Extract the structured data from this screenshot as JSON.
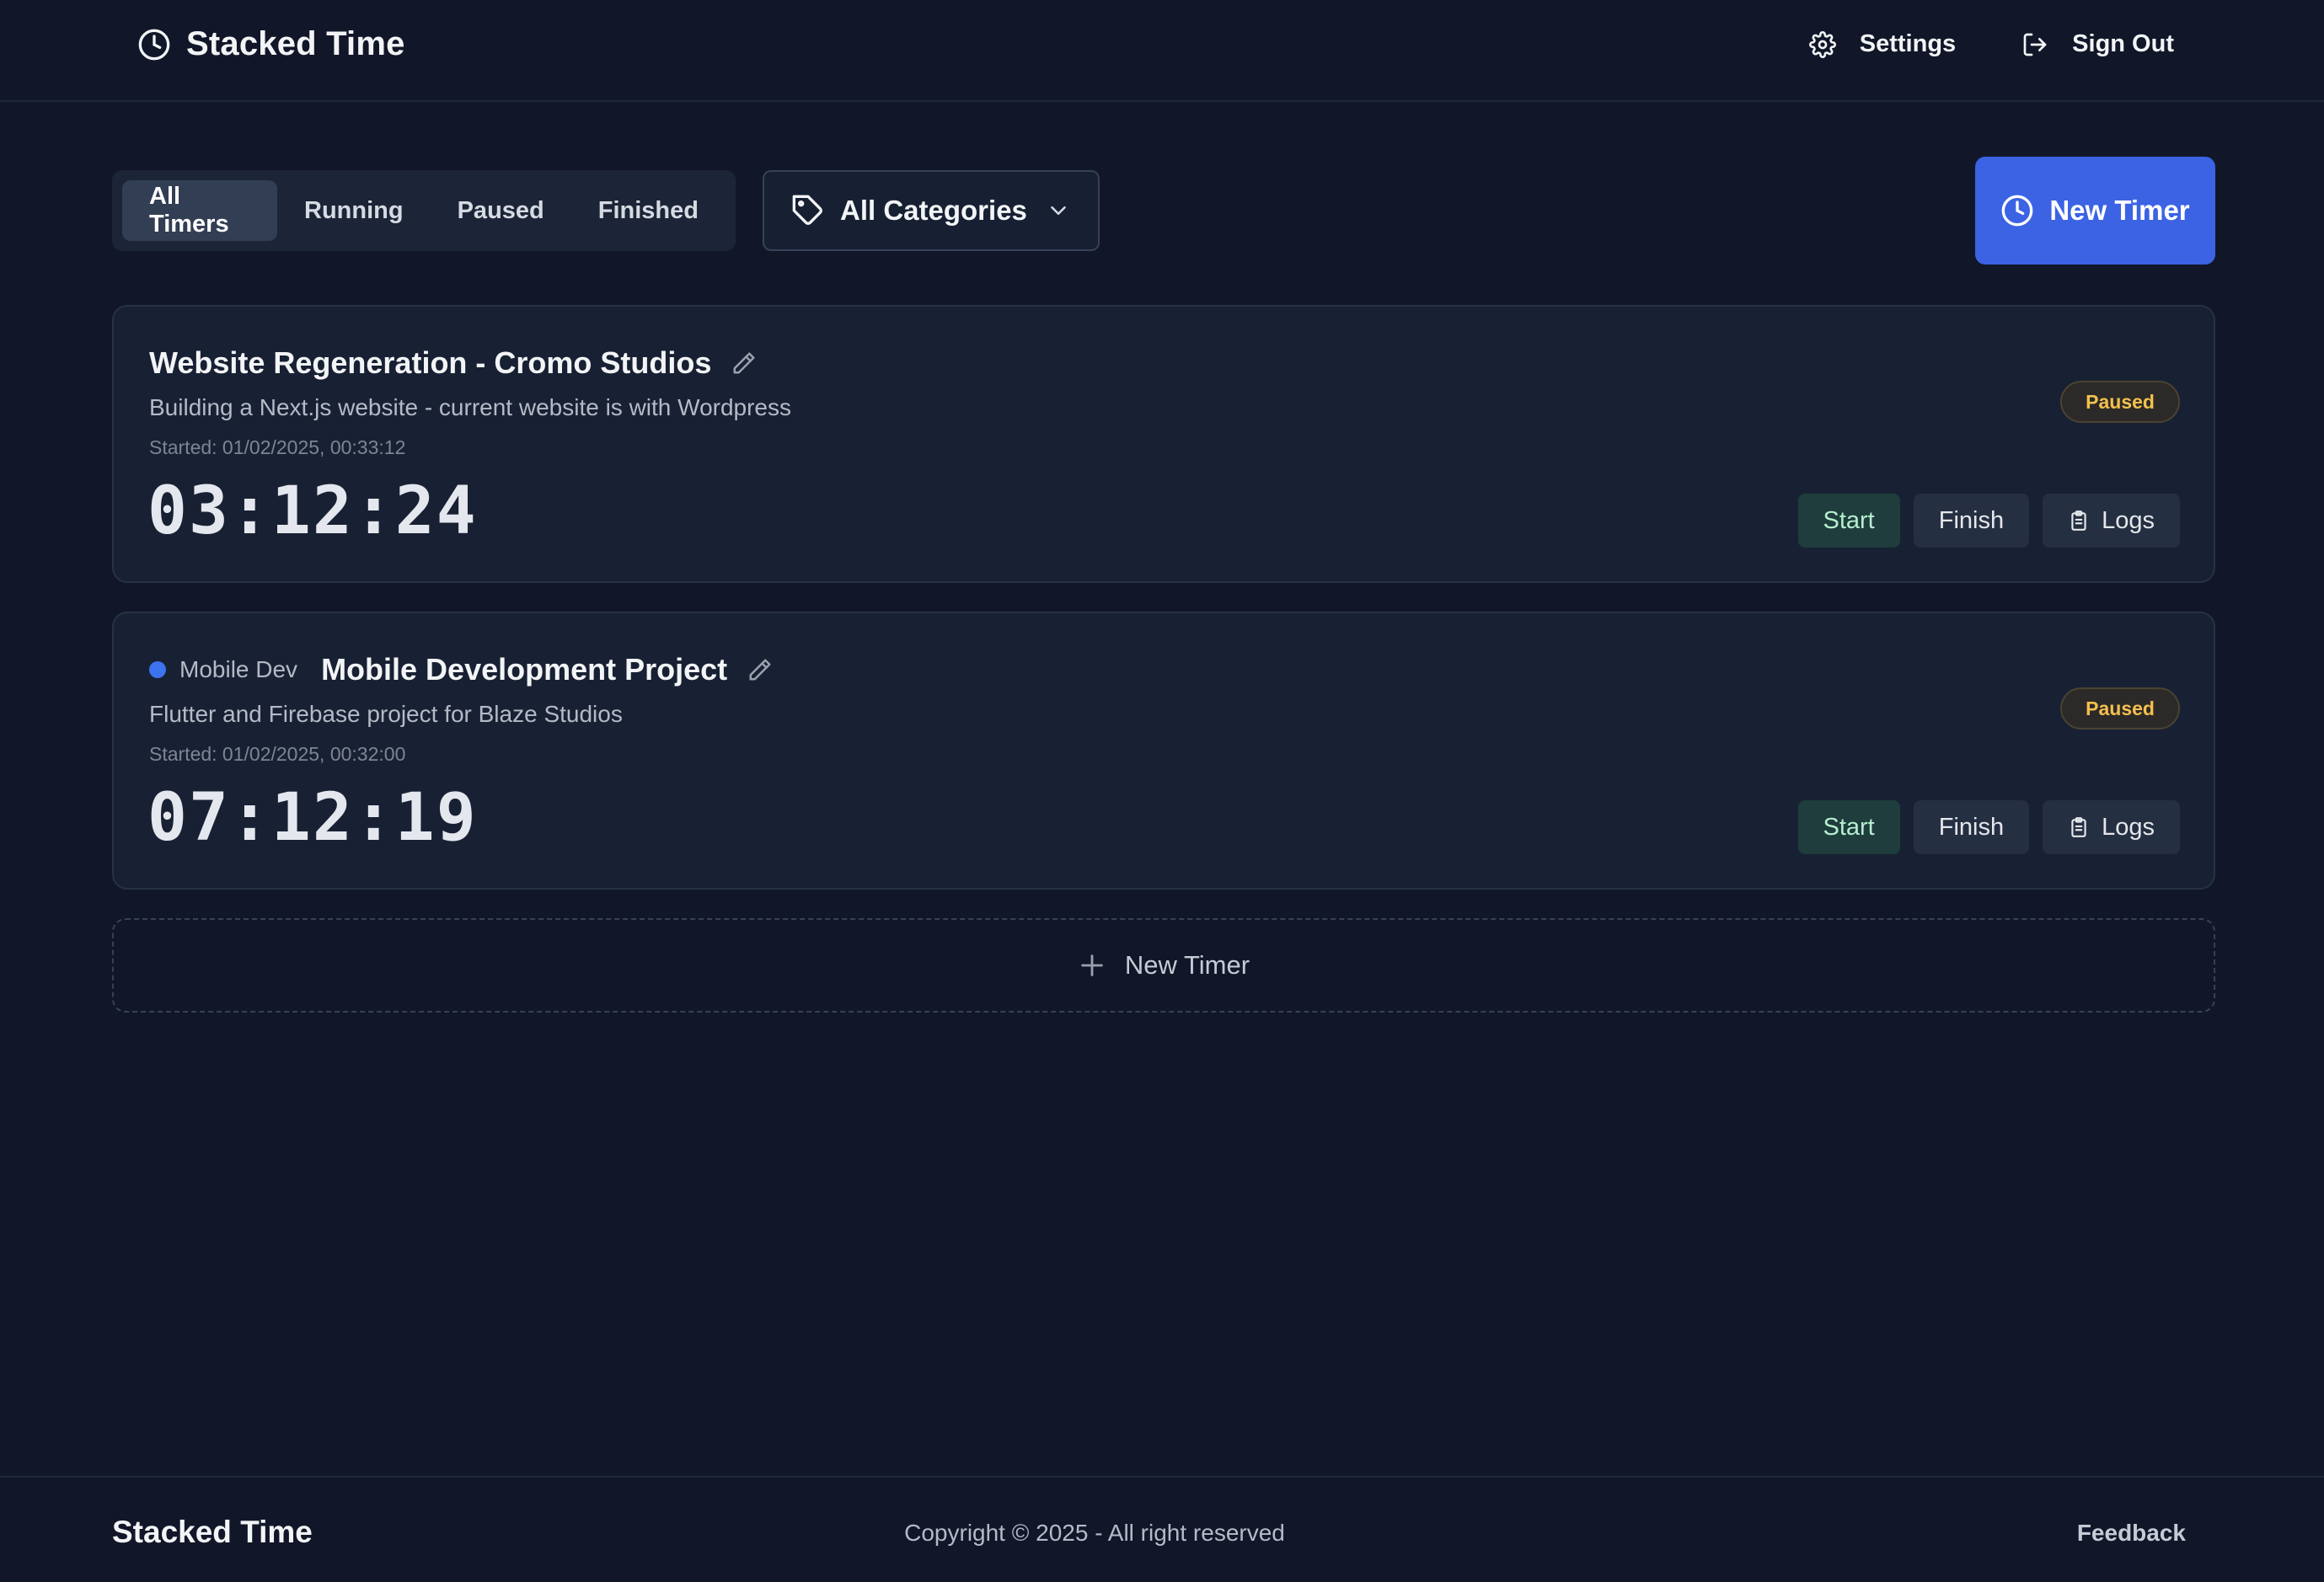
{
  "app": {
    "brand": "Stacked Time"
  },
  "nav": {
    "settings": "Settings",
    "sign_out": "Sign Out"
  },
  "filters": {
    "tabs": [
      "All Timers",
      "Running",
      "Paused",
      "Finished"
    ],
    "active": "All Timers"
  },
  "category_filter": {
    "label": "All Categories"
  },
  "new_timer_button": "New Timer",
  "timers": [
    {
      "title": "Website Regeneration - Cromo Studios",
      "category": "",
      "description": "Building a Next.js website - current website is with Wordpress",
      "started": "Started: 01/02/2025, 00:33:12",
      "elapsed": "03:12:24",
      "status": "Paused",
      "actions": {
        "start": "Start",
        "finish": "Finish",
        "logs": "Logs"
      }
    },
    {
      "title": "Mobile Development Project",
      "category": "Mobile Dev",
      "category_color": "#3b73f0",
      "description": "Flutter and Firebase project for Blaze Studios",
      "started": "Started: 01/02/2025, 00:32:00",
      "elapsed": "07:12:19",
      "status": "Paused",
      "actions": {
        "start": "Start",
        "finish": "Finish",
        "logs": "Logs"
      }
    }
  ],
  "add_timer": "New Timer",
  "footer": {
    "brand": "Stacked Time",
    "copyright": "Copyright © 2025 - All right reserved",
    "feedback": "Feedback"
  },
  "icons": {
    "brand": "clock-icon",
    "settings": "gear-icon",
    "sign_out": "sign-out-icon",
    "category": "tag-icon",
    "dropdown": "chevron-down-icon",
    "edit": "pencil-icon",
    "logs": "clipboard-icon",
    "add": "plus-icon"
  },
  "colors": {
    "background": "#111729",
    "accent": "#3b63e4",
    "paused": "#f4c04e",
    "start": "#1e3d3c"
  }
}
